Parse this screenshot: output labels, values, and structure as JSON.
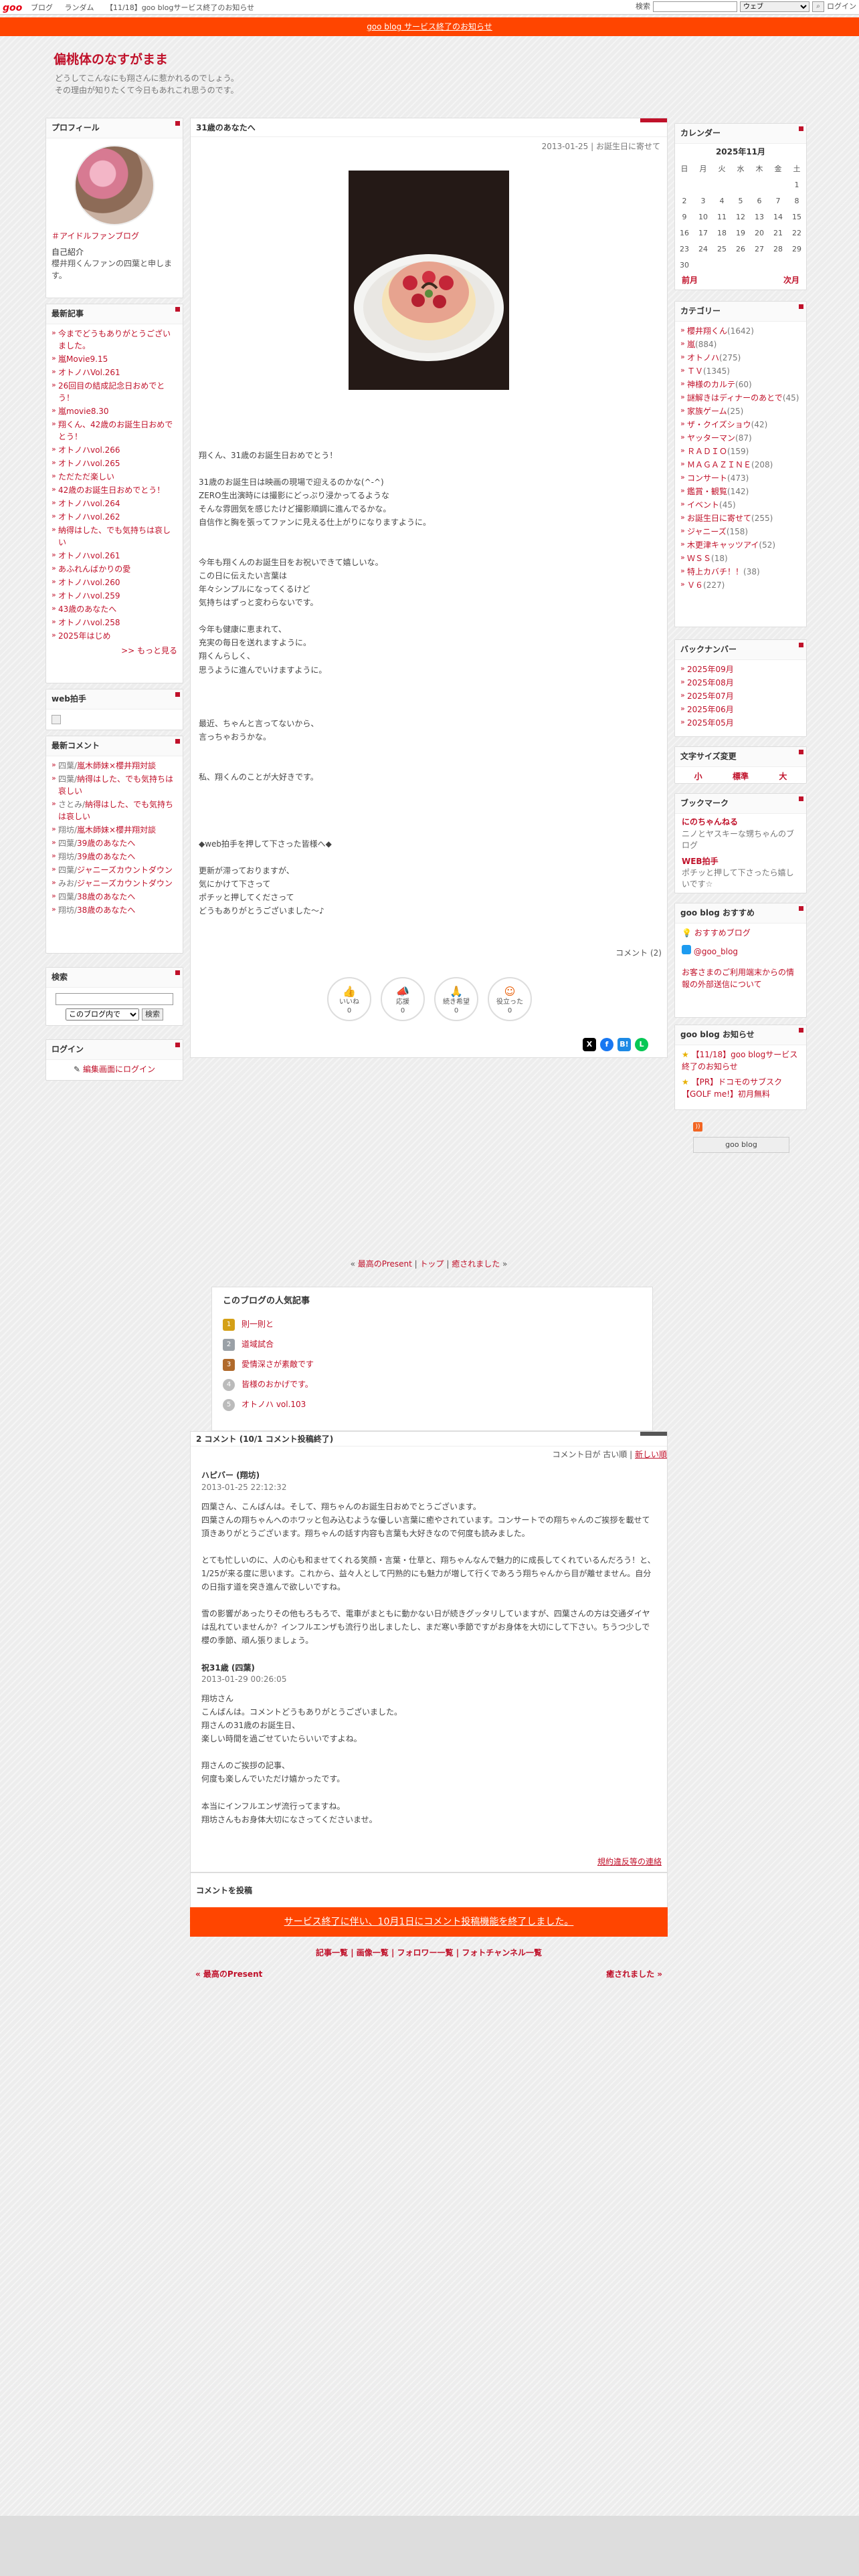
{
  "topbar": {
    "logo": "goo",
    "nav": [
      "ブログ",
      "ランダム",
      "【11/18】goo blogサービス終了のお知らせ"
    ],
    "search_label": "検索",
    "search_select": "ウェブ",
    "login": "ログイン"
  },
  "banner": "goo blog サービス終了のお知らせ",
  "blog": {
    "title": "偏桃体のなすがまま",
    "desc_line1": "どうしてこんなにも翔さんに惹かれるのでしょう。",
    "desc_line2": "その理由が知りたくて今日もあれこれ思うのです。"
  },
  "profile": {
    "heading": "プロフィール",
    "name": "＃アイドルファンブログ",
    "intro_label": "自己紹介",
    "intro": "櫻井翔くんファンの四葉と申します。"
  },
  "recent": {
    "heading": "最新記事",
    "items": [
      "今までどうもありがとうございました。",
      "嵐Movie9.15",
      "オトノハVol.261",
      "26回目の結成記念日おめでとう！",
      "嵐movie8.30",
      "翔くん、42歳のお誕生日おめでとう！",
      "オトノハvol.266",
      "オトノハvol.265",
      "ただただ楽しい",
      "42歳のお誕生日おめでとう！",
      "オトノハvol.264",
      "オトノハvol.262",
      "納得はした、でも気持ちは哀しい",
      "オトノハvol.261",
      "あふれんばかりの愛",
      "オトノハvol.260",
      "オトノハvol.259",
      "43歳のあなたへ",
      "オトノハvol.258",
      "2025年はじめ"
    ],
    "more": ">> もっと見る"
  },
  "webclap": {
    "heading": "web拍手"
  },
  "recent_comments": {
    "heading": "最新コメント",
    "items": [
      [
        "四葉/",
        "嵐木師妹×櫻井翔対談"
      ],
      [
        "四葉/",
        "納得はした、でも気持ちは哀しい"
      ],
      [
        "さとみ/",
        "納得はした、でも気持ちは哀しい"
      ],
      [
        "翔坊/",
        "嵐木師妹×櫻井翔対談"
      ],
      [
        "四葉/",
        "39歳のあなたへ"
      ],
      [
        "翔坊/",
        "39歳のあなたへ"
      ],
      [
        "四葉/",
        "ジャニーズカウントダウン"
      ],
      [
        "みお/",
        "ジャニーズカウントダウン"
      ],
      [
        "四葉/",
        "38歳のあなたへ"
      ],
      [
        "翔坊/",
        "38歳のあなたへ"
      ]
    ]
  },
  "search": {
    "heading": "検索",
    "scope": "このブログ内で",
    "button": "検索"
  },
  "login": {
    "heading": "ログイン",
    "link": "編集画面にログイン"
  },
  "entry": {
    "title": "31歳のあなたへ",
    "date": "2013-01-25",
    "category": "お誕生日に寄せて",
    "body": "翔くん、31歳のお誕生日おめでとう！\n\n31歳のお誕生日は映画の現場で迎えるのかな(^-^)\nZERO生出演時には撮影にどっぷり浸かってるような\nそんな雰囲気を感じたけど撮影順調に進んでるかな。\n自信作と胸を張ってファンに見える仕上がりになりますように。\n\n\n今年も翔くんのお誕生日をお祝いできて嬉しいな。\nこの日に伝えたい言葉は\n年々シンプルになってくるけど\n気持ちはずっと変わらないです。\n\n今年も健康に恵まれて、\n充実の毎日を送れますように。\n翔くんらしく、\n思うように進んでいけますように。\n\n\n\n最近、ちゃんと言ってないから、\n言っちゃおうかな。\n\n\n私、翔くんのことが大好きです。\n\n\n\n\n◆web拍手を押して下さった皆様へ◆\n\n更新が滞っておりますが、\n気にかけて下さって\nポチッと押してくださって\nどうもありがとうございました〜♪",
    "comments_link": "コメント (2)"
  },
  "reactions": [
    {
      "label": "いいね",
      "count": "0"
    },
    {
      "label": "応援",
      "count": "0"
    },
    {
      "label": "続き希望",
      "count": "0"
    },
    {
      "label": "役立った",
      "count": "0"
    }
  ],
  "pagenav": {
    "prev": "最高のPresent",
    "top": "トップ",
    "next": "癒されました"
  },
  "popular": {
    "heading": "このブログの人気記事",
    "items": [
      "則一則と",
      "道域試合",
      "愛情深さが素敵です",
      "皆様のおかげです。",
      "オトノハ vol.103"
    ]
  },
  "comments": {
    "heading": "2 コメント (10/1 コメント投稿終了)",
    "order_label": "コメント日が",
    "old": "古い順",
    "new": "新しい順",
    "list": [
      {
        "name": "ハピバー (翔坊)",
        "time": "2013-01-25 22:12:32",
        "text": "四葉さん、こんばんは。そして、翔ちゃんのお誕生日おめでとうございます。\n四葉さんの翔ちゃんへのホワッと包み込むような優しい言葉に癒やされています。コンサートでの翔ちゃんのご挨拶を載せて頂きありがとうございます。翔ちゃんの話す内容も言葉も大好きなので何度も読みました。\n\nとても忙しいのに、人の心も和ませてくれる笑顔・言葉・仕草と、翔ちゃんなんで魅力的に成長してくれているんだろう！と、1/25が来る度に思います。これから、益々人として円熟的にも魅力が増して行くであろう翔ちゃんから目が離せません。自分の日指す道を突き進んで欲しいですね。\n\n雪の影響があったりその他もろもろで、電車がまともに動かない日が続きグッタリしていますが、四葉さんの方は交通ダイヤは乱れていませんか？インフルエンザも流行り出しましたし、まだ寒い季節ですがお身体を大切にして下さい。ちうつ少しで櫻の季節、頑ん張りましょう。"
      },
      {
        "name": "祝31歳 (四葉)",
        "time": "2013-01-29 00:26:05",
        "text": "翔坊さん\nこんばんは。コメントどうもありがとうございました。\n翔さんの31歳のお誕生日、\n楽しい時間を過ごせていたらいいですよね。\n\n翔さんのご挨拶の記事、\n何度も楽しんでいただけ嬉かったです。\n\n本当にインフルエンザ流行ってますね。\n翔坊さんもお身体大切になさってくださいませ。"
      }
    ],
    "report": "規約違反等の連絡"
  },
  "post_comment": {
    "heading": "コメントを投稿",
    "notice": "サービス終了に伴い、10月1日にコメント投稿機能を終了しました。"
  },
  "footer_nav": [
    "記事一覧",
    "画像一覧",
    "フォロワー一覧",
    "フォトチャンネル一覧"
  ],
  "footer_prev": "« 最高のPresent",
  "footer_next": "癒されました »",
  "calendar": {
    "heading": "カレンダー",
    "title": "2025年11月",
    "days": [
      "日",
      "月",
      "火",
      "水",
      "木",
      "金",
      "土"
    ],
    "weeks": [
      [
        "",
        "",
        "",
        "",
        "",
        "",
        "1"
      ],
      [
        "2",
        "3",
        "4",
        "5",
        "6",
        "7",
        "8"
      ],
      [
        "9",
        "10",
        "11",
        "12",
        "13",
        "14",
        "15"
      ],
      [
        "16",
        "17",
        "18",
        "19",
        "20",
        "21",
        "22"
      ],
      [
        "23",
        "24",
        "25",
        "26",
        "27",
        "28",
        "29"
      ],
      [
        "30",
        "",
        "",
        "",
        "",
        "",
        ""
      ]
    ],
    "prev": "前月",
    "next": "次月"
  },
  "categories": {
    "heading": "カテゴリー",
    "items": [
      [
        "櫻井翔くん",
        "(1642)"
      ],
      [
        "嵐",
        "(884)"
      ],
      [
        "オトノハ",
        "(275)"
      ],
      [
        "ＴＶ",
        "(1345)"
      ],
      [
        "神様のカルテ",
        "(60)"
      ],
      [
        "謎解きはディナーのあとで",
        "(45)"
      ],
      [
        "家族ゲーム",
        "(25)"
      ],
      [
        "ザ・クイズショウ",
        "(42)"
      ],
      [
        "ヤッターマン",
        "(87)"
      ],
      [
        "ＲＡＤＩＯ",
        "(159)"
      ],
      [
        "ＭＡＧＡＺＩＮＥ",
        "(208)"
      ],
      [
        "コンサート",
        "(473)"
      ],
      [
        "鑑賞・観覧",
        "(142)"
      ],
      [
        "イベント",
        "(45)"
      ],
      [
        "お誕生日に寄せて",
        "(255)"
      ],
      [
        "ジャニーズ",
        "(158)"
      ],
      [
        "木更津キャッツアイ",
        "(52)"
      ],
      [
        "ＷＳＳ",
        "(18)"
      ],
      [
        "特上カバチ！！",
        "(38)"
      ],
      [
        "Ｖ６",
        "(227)"
      ]
    ]
  },
  "backnumber": {
    "heading": "バックナンバー",
    "items": [
      "2025年09月",
      "2025年08月",
      "2025年07月",
      "2025年06月",
      "2025年05月"
    ]
  },
  "fontsize": {
    "heading": "文字サイズ変更",
    "small": "小",
    "mid": "標準",
    "large": "大"
  },
  "bookmark": {
    "heading": "ブックマーク",
    "items": [
      {
        "title": "にのちゃんねる",
        "desc": "ニノとヤスキーな甥ちゃんのブログ"
      },
      {
        "title": "WEB拍手",
        "desc": "ポチッと押して下さったら嬉しいです☆"
      }
    ]
  },
  "goo_recommend": {
    "heading": "goo blog おすすめ",
    "items": [
      "おすすめブログ",
      "@goo_blog"
    ],
    "notice": "お客さまのご利用端末からの情報の外部送信について"
  },
  "goo_notice": {
    "heading": "goo blog お知らせ",
    "items": [
      "【11/18】goo blogサービス終了のお知らせ",
      "【PR】ドコモのサブスク【GOLF me!】初月無料"
    ]
  },
  "gooblog_badge": "goo blog",
  "colors": {
    "accent": "#c0112a",
    "banner": "#ff4500"
  }
}
